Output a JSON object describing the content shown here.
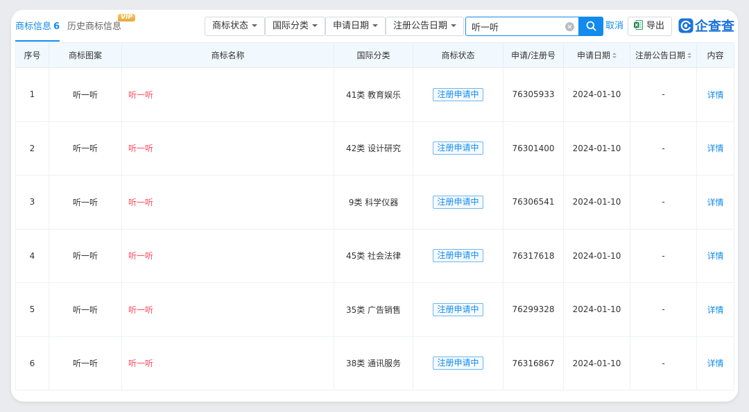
{
  "tabs": {
    "active_label": "商标信息",
    "active_count": "6",
    "history_label": "历史商标信息",
    "vip_badge": "VIP"
  },
  "filters": [
    {
      "label": "商标状态"
    },
    {
      "label": "国际分类"
    },
    {
      "label": "申请日期"
    },
    {
      "label": "注册公告日期"
    }
  ],
  "search": {
    "value": "听一听",
    "cancel_label": "取消"
  },
  "export_label": "导出",
  "logo_text": "企查查",
  "colors": {
    "accent": "#128bed",
    "name_red": "#fd485e",
    "header_bg": "#f2f9fe"
  },
  "table": {
    "columns": [
      "序号",
      "商标图案",
      "商标名称",
      "国际分类",
      "商标状态",
      "申请/注册号",
      "申请日期",
      "注册公告日期",
      "内容"
    ],
    "rows": [
      {
        "index": "1",
        "image": "听一听",
        "name": "听一听",
        "class": "41类 教育娱乐",
        "status": "注册申请中",
        "reg_no": "76305933",
        "apply_date": "2024-01-10",
        "announce_date": "-",
        "action": "详情"
      },
      {
        "index": "2",
        "image": "听一听",
        "name": "听一听",
        "class": "42类 设计研究",
        "status": "注册申请中",
        "reg_no": "76301400",
        "apply_date": "2024-01-10",
        "announce_date": "-",
        "action": "详情"
      },
      {
        "index": "3",
        "image": "听一听",
        "name": "听一听",
        "class": "9类 科学仪器",
        "status": "注册申请中",
        "reg_no": "76306541",
        "apply_date": "2024-01-10",
        "announce_date": "-",
        "action": "详情"
      },
      {
        "index": "4",
        "image": "听一听",
        "name": "听一听",
        "class": "45类 社会法律",
        "status": "注册申请中",
        "reg_no": "76317618",
        "apply_date": "2024-01-10",
        "announce_date": "-",
        "action": "详情"
      },
      {
        "index": "5",
        "image": "听一听",
        "name": "听一听",
        "class": "35类 广告销售",
        "status": "注册申请中",
        "reg_no": "76299328",
        "apply_date": "2024-01-10",
        "announce_date": "-",
        "action": "详情"
      },
      {
        "index": "6",
        "image": "听一听",
        "name": "听一听",
        "class": "38类 通讯服务",
        "status": "注册申请中",
        "reg_no": "76316867",
        "apply_date": "2024-01-10",
        "announce_date": "-",
        "action": "详情"
      }
    ]
  }
}
